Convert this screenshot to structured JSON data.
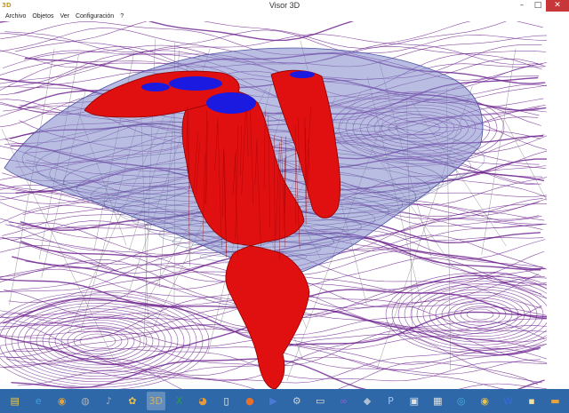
{
  "window": {
    "title": "Visor 3D",
    "app_icon": "3D",
    "minimize_glyph": "–",
    "maximize_glyph": "□",
    "close_glyph": "✕"
  },
  "menu": {
    "items": [
      {
        "label": "Archivo"
      },
      {
        "label": "Objetos"
      },
      {
        "label": "Ver"
      },
      {
        "label": "Configuración"
      },
      {
        "label": "?"
      }
    ]
  },
  "scene": {
    "contour_color": "#6a1e8c",
    "orebody_color": "#e01010",
    "orebody_top_color": "#1a1ae0",
    "pit_shell_color": "#7f86c8",
    "wire_color": "#555555"
  },
  "taskbar": {
    "color": "#2e68a8",
    "items": [
      {
        "name": "windows-explorer-icon",
        "glyph": "▤",
        "color": "#f2c94c"
      },
      {
        "name": "internet-explorer-icon",
        "glyph": "e",
        "color": "#3aa0e8"
      },
      {
        "name": "chrome-icon",
        "glyph": "◉",
        "color": "#e8a43a"
      },
      {
        "name": "app-icon-generic",
        "glyph": "◍",
        "color": "#b0b0b0"
      },
      {
        "name": "itunes-icon",
        "glyph": "♪",
        "color": "#9ab0c8"
      },
      {
        "name": "app-icon-yellow",
        "glyph": "✿",
        "color": "#e8c24a"
      },
      {
        "name": "visor-3d-icon",
        "glyph": "3D",
        "color": "#d0b060",
        "active": true
      },
      {
        "name": "excel-icon",
        "glyph": "X",
        "color": "#2e9a4a"
      },
      {
        "name": "paint-icon",
        "glyph": "◕",
        "color": "#e89a3a"
      },
      {
        "name": "document-icon",
        "glyph": "▯",
        "color": "#ffffff"
      },
      {
        "name": "firefox-icon",
        "glyph": "●",
        "color": "#e8702a"
      },
      {
        "name": "media-player-icon",
        "glyph": "▶",
        "color": "#4a7ad8"
      },
      {
        "name": "app-icon-gear",
        "glyph": "⚙",
        "color": "#d0d0d0"
      },
      {
        "name": "window-icon",
        "glyph": "▭",
        "color": "#e0e0e0"
      },
      {
        "name": "visual-studio-icon",
        "glyph": "∞",
        "color": "#9a5ad0"
      },
      {
        "name": "app-icon-cube",
        "glyph": "◆",
        "color": "#b0c0d0"
      },
      {
        "name": "app-icon-p",
        "glyph": "P",
        "color": "#a0c0e8"
      },
      {
        "name": "app-icon-window",
        "glyph": "▣",
        "color": "#e0e0e0"
      },
      {
        "name": "app-icon-data",
        "glyph": "▦",
        "color": "#e0e0e0"
      },
      {
        "name": "app-icon-ring",
        "glyph": "◎",
        "color": "#4ab0e0"
      },
      {
        "name": "chrome-icon-2",
        "glyph": "◉",
        "color": "#e8c24a"
      },
      {
        "name": "word-icon",
        "glyph": "W",
        "color": "#3a6ad8"
      },
      {
        "name": "app-icon-dark",
        "glyph": "▪",
        "color": "#f0e0a0"
      },
      {
        "name": "app-icon-terminal",
        "glyph": "▬",
        "color": "#e8a43a"
      }
    ]
  }
}
